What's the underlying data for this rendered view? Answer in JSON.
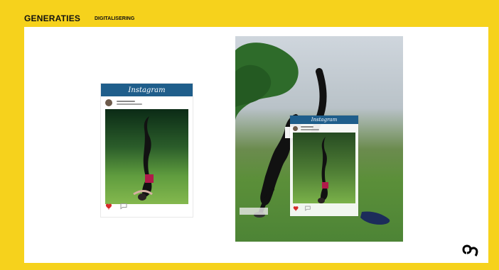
{
  "header": {
    "left_tag": "GENERATIES",
    "right_tag": "DIGITALISERING"
  },
  "left_card": {
    "brand": "Instagram",
    "icons": [
      "avatar",
      "heart-icon",
      "comment-icon"
    ]
  },
  "right_photo": {
    "overlay_brand": "Instagram",
    "icons": [
      "avatar",
      "heart-icon",
      "comment-icon"
    ]
  },
  "colors": {
    "frame_yellow": "#f6d21c",
    "instagram_blue": "#1f5e8b",
    "heart_red": "#d62a2a"
  },
  "footer_logo": {
    "icon": "q-logo-icon"
  }
}
